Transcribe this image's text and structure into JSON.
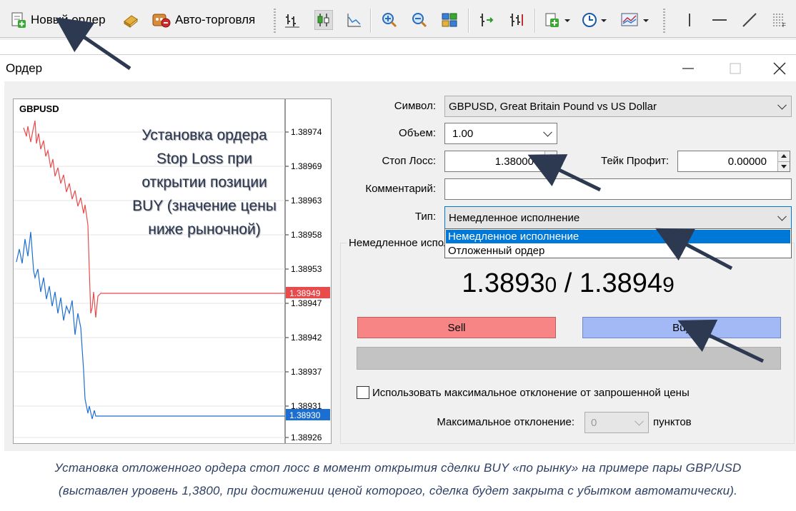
{
  "toolbar": {
    "new_order": "Новый ордер",
    "auto_trading": "Авто-торговля"
  },
  "window": {
    "title": "Ордер"
  },
  "chart": {
    "symbol": "GBPUSD",
    "note": "Установка ордера\nStop Loss при\nоткрытии позиции\nBUY (значение цены\nниже рыночной)",
    "ticks": [
      "1.38974",
      "1.38969",
      "1.38963",
      "1.38958",
      "1.38953",
      "1.38947",
      "1.38942",
      "1.38937",
      "1.38931",
      "1.38926"
    ],
    "ask_label": "1.38949",
    "bid_label": "1.38930",
    "ask_color": "#e84b4b",
    "bid_color": "#1c6fd1"
  },
  "form": {
    "symbol_label": "Символ:",
    "symbol_value": "GBPUSD, Great Britain Pound vs US Dollar",
    "volume_label": "Объем:",
    "volume_value": "1.00",
    "sl_label": "Стоп Лосс:",
    "sl_value": "1.38000",
    "tp_label": "Тейк Профит:",
    "tp_value": "0.00000",
    "comment_label": "Комментарий:",
    "comment_value": "",
    "type_label": "Тип:",
    "type_value": "Немедленное исполнение",
    "type_options": [
      "Немедленное исполнение",
      "Отложенный ордер"
    ],
    "group_title": "Немедленное исполнение",
    "bid_main": "1.3893",
    "bid_last": "0",
    "ask_main": "1.3894",
    "ask_last": "9",
    "price_sep": "/",
    "sell_label": "Sell",
    "buy_label": "Buy",
    "max_dev_check_label": "Использовать максимальное отклонение от запрошенной цены",
    "max_dev_label": "Максимальное отклонение:",
    "max_dev_value": "0",
    "points_label": "пунктов"
  },
  "caption": {
    "line1": "Установка отложенного ордера стоп лосс в момент открытия сделки BUY «по рынку» на примере пары GBP/USD",
    "line2": "(выставлен уровень 1,3800, при достижении ценой которого, сделка будет закрыта с убытком автоматически)."
  },
  "colors": {
    "sell": "#f88585",
    "buy": "#a3b9f5",
    "selection": "#0078d7",
    "caption": "#2d3f64"
  }
}
